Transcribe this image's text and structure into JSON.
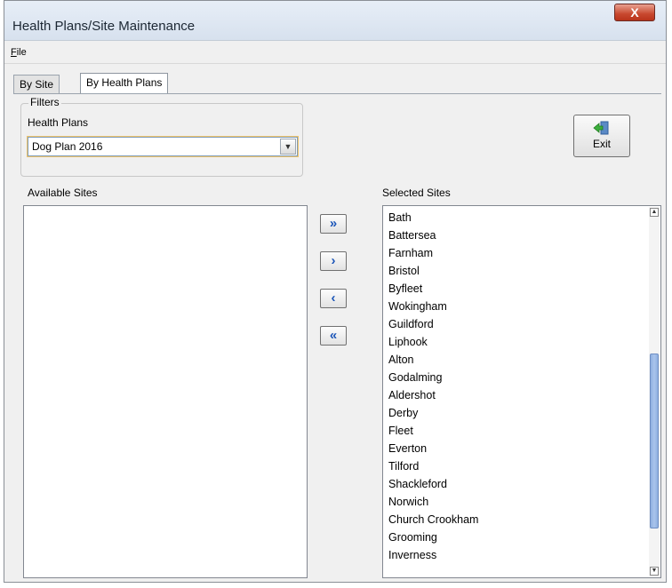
{
  "window": {
    "title": "Health Plans/Site Maintenance",
    "close_glyph": "X"
  },
  "menu": {
    "file_label": "ile",
    "file_accel": "F"
  },
  "tabs": [
    {
      "label": "By Site",
      "active": false
    },
    {
      "label": "By Health Plans",
      "active": true
    }
  ],
  "filters": {
    "legend": "Filters",
    "health_plans_label": "Health Plans",
    "health_plan_value": "Dog Plan 2016"
  },
  "exit_button": {
    "label": "Exit",
    "icon": "exit-door-icon"
  },
  "available_sites": {
    "label": "Available Sites",
    "items": []
  },
  "selected_sites": {
    "label": "Selected Sites",
    "items": [
      "Bath",
      "Battersea",
      "Farnham",
      "Bristol",
      "Byfleet",
      "Wokingham",
      "Guildford",
      "Liphook",
      "Alton",
      "Godalming",
      "Aldershot",
      "Derby",
      "Fleet",
      "Everton",
      "Tilford",
      "Shackleford",
      "Norwich",
      "Church Crookham",
      "Grooming",
      "Inverness"
    ]
  },
  "move_buttons": {
    "add_all": "»",
    "add_one": "›",
    "remove_one": "‹",
    "remove_all": "«"
  },
  "colors": {
    "button_arrow": "#1b55b8",
    "scroll_thumb": "#8fb0e0",
    "close_button": "#c8482e"
  }
}
